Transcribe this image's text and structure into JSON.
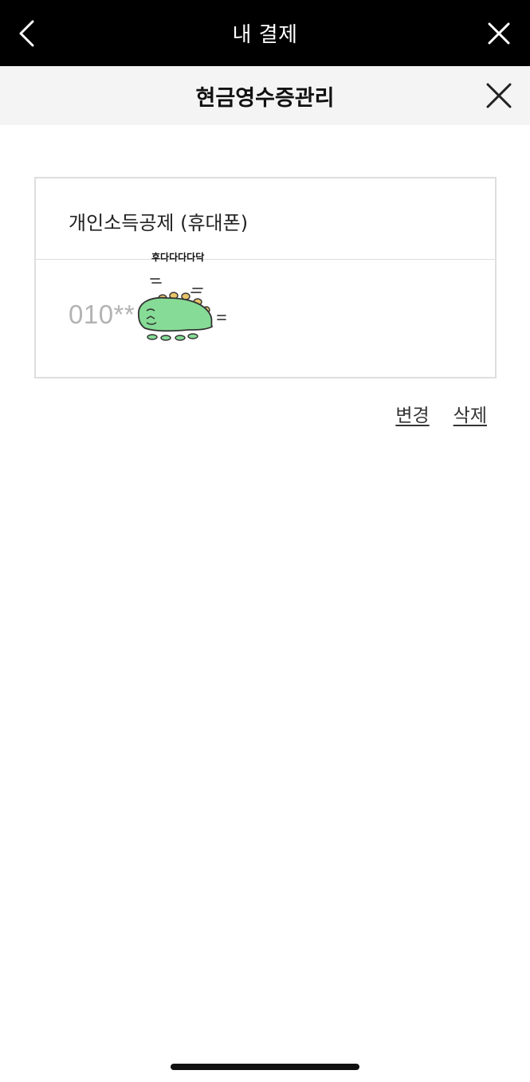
{
  "header": {
    "title": "내 결제"
  },
  "subheader": {
    "title": "현금영수증관리"
  },
  "receipt": {
    "type_label": "개인소득공제 (휴대폰)",
    "phone": "010**"
  },
  "sticker": {
    "caption": "후다다다다닥"
  },
  "actions": {
    "change_label": "변경",
    "delete_label": "삭제"
  }
}
